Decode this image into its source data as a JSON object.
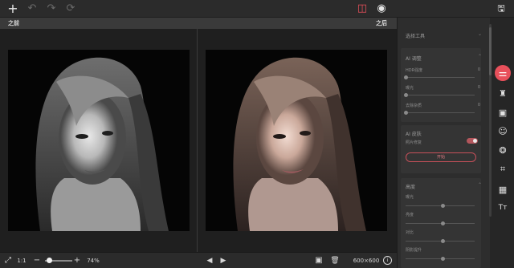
{
  "topbar": {
    "add_icon": "+",
    "undo_icon": "↶",
    "redo_icon": "↷",
    "reset_icon": "⟳",
    "compare_icon": "◫",
    "preview_icon": "◉",
    "save_icon": "🖫"
  },
  "compare": {
    "before_label": "之前",
    "after_label": "之后"
  },
  "bottombar": {
    "fit_icon": "⤢",
    "ratio_label": "1:1",
    "zoom_out_icon": "−",
    "zoom_in_icon": "+",
    "zoom_value": "74%",
    "zoom_level": 0.74,
    "prev_icon": "◀",
    "next_icon": "▶",
    "image_icon": "▣",
    "delete_icon": "🗑",
    "dimensions": "600×600",
    "info_icon": "i"
  },
  "panel": {
    "select_tool": "选择工具",
    "ai_adjust": {
      "title": "AI 调整",
      "sliders": [
        {
          "label": "HDR强度",
          "value": "0"
        },
        {
          "label": "曝光",
          "value": "0"
        },
        {
          "label": "去除杂质",
          "value": "0"
        }
      ]
    },
    "ai_skin": {
      "title": "AI 皮肤",
      "toggle_label": "照片修复",
      "apply_label": "开始"
    },
    "light": {
      "title": "高度",
      "sliders": [
        {
          "label": "曝光"
        },
        {
          "label": "亮度"
        },
        {
          "label": "对比"
        },
        {
          "label": "阴影提升"
        }
      ]
    }
  },
  "rail": {
    "adjust_icon": "⚌",
    "stamp_icon": "♜",
    "image_icon": "▣",
    "face_icon": "☺",
    "color_icon": "❂",
    "crop_icon": "⌗",
    "frame_icon": "▦",
    "text_icon": "Tт"
  },
  "colors": {
    "accent": "#e8505b",
    "background": "#262626",
    "panel": "#2d2d2d"
  }
}
